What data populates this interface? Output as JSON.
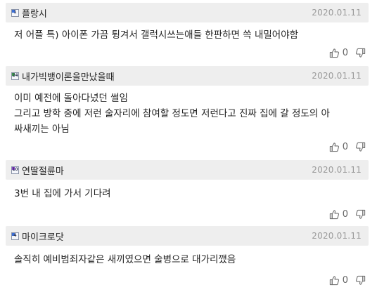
{
  "comments": [
    {
      "level_icon_text": "1",
      "level_color": "#3b6fd6",
      "nickname": "플랑시",
      "date": "2020.01.11",
      "body": "저 어플 특) 아이폰 가끔 튕겨서 갤럭시쓰는애들 한판하면 쓱 내밀어야함",
      "upvotes": "0"
    },
    {
      "level_icon_text": "24",
      "level_color": "#3aa04a",
      "nickname": "내가빅뱅이론을만났을때",
      "date": "2020.01.11",
      "body": "이미 예전에 돌아다녔던 썰임\n그리고 방학 중에 저런 술자리에 참여할 정도면 저런다고 진짜 집에 갈 정도의 아\n싸새끼는 아님",
      "upvotes": "0"
    },
    {
      "level_icon_text": "10",
      "level_color": "#8a3fd0",
      "nickname": "연딸절륜마",
      "date": "2020.01.11",
      "body": "3번 내 집에 가서 기다려",
      "upvotes": "0"
    },
    {
      "level_icon_text": "4",
      "level_color": "#3b6fd6",
      "nickname": "마이크로닷",
      "date": "2020.01.11",
      "body": "솔직히 예비범죄자같은 새끼였으면 술병으로 대가리깼음",
      "upvotes": "0"
    }
  ],
  "icons": {
    "upvote": "thumbs-up-icon",
    "downvote": "thumbs-down-icon"
  }
}
